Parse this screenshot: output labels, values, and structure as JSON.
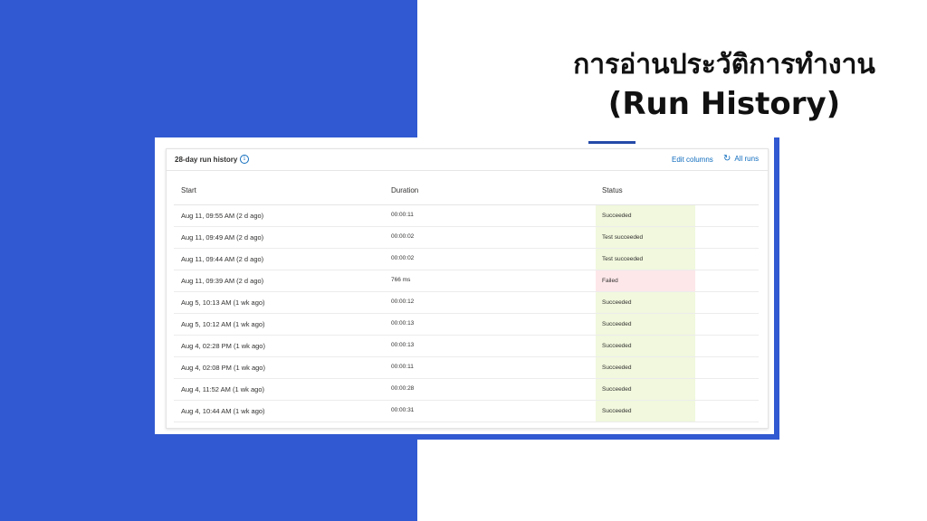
{
  "slide": {
    "title_line1": "การอ่านประวัติการทำงาน",
    "title_line2": "(Run History)"
  },
  "panel": {
    "title": "28-day run history",
    "info_icon": "info-icon",
    "edit_columns_label": "Edit columns",
    "all_runs_label": "All runs",
    "refresh_icon": "refresh-icon",
    "headers": {
      "start": "Start",
      "duration": "Duration",
      "status": "Status"
    },
    "rows": [
      {
        "start": "Aug 11, 09:55 AM (2 d ago)",
        "duration": "00:00:11",
        "status": "Succeeded"
      },
      {
        "start": "Aug 11, 09:49 AM (2 d ago)",
        "duration": "00:00:02",
        "status": "Test succeeded"
      },
      {
        "start": "Aug 11, 09:44 AM (2 d ago)",
        "duration": "00:00:02",
        "status": "Test succeeded"
      },
      {
        "start": "Aug 11, 09:39 AM (2 d ago)",
        "duration": "766 ms",
        "status": "Failed"
      },
      {
        "start": "Aug 5, 10:13 AM (1 wk ago)",
        "duration": "00:00:12",
        "status": "Succeeded"
      },
      {
        "start": "Aug 5, 10:12 AM (1 wk ago)",
        "duration": "00:00:13",
        "status": "Succeeded"
      },
      {
        "start": "Aug 4, 02:28 PM (1 wk ago)",
        "duration": "00:00:13",
        "status": "Succeeded"
      },
      {
        "start": "Aug 4, 02:08 PM (1 wk ago)",
        "duration": "00:00:11",
        "status": "Succeeded"
      },
      {
        "start": "Aug 4, 11:52 AM (1 wk ago)",
        "duration": "00:00:28",
        "status": "Succeeded"
      },
      {
        "start": "Aug 4, 10:44 AM (1 wk ago)",
        "duration": "00:00:31",
        "status": "Succeeded"
      }
    ]
  },
  "colors": {
    "background_blue": "#3159d1",
    "link_blue": "#0f6cbd",
    "success_bg": "#f1f8dd",
    "failed_bg": "#fde7e9"
  }
}
